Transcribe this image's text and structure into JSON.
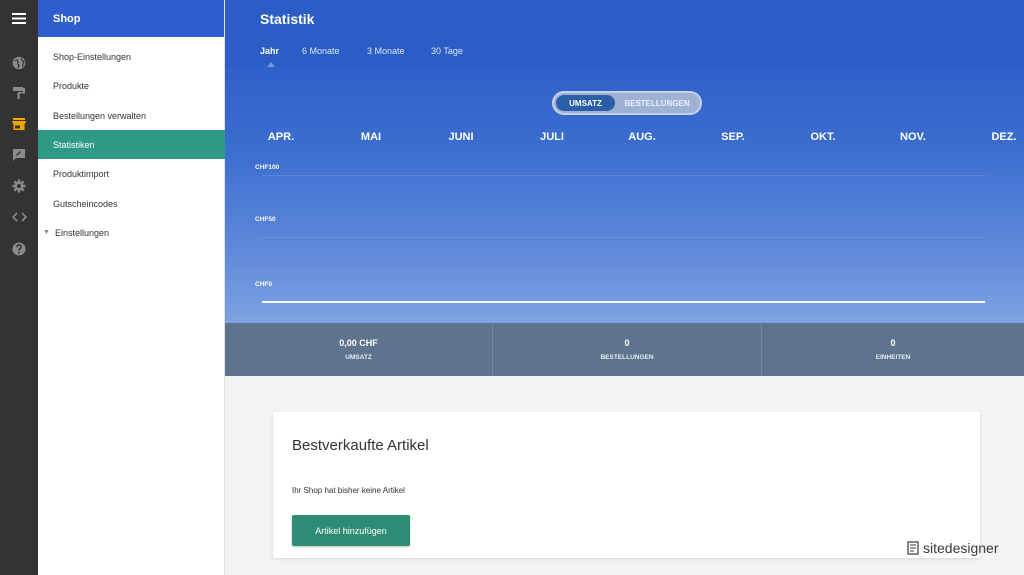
{
  "rail": {
    "icons": [
      "menu-icon",
      "globe-icon",
      "paint-roller-icon",
      "store-icon",
      "feedback-icon",
      "gear-icon",
      "code-icon",
      "help-icon"
    ]
  },
  "sidebar": {
    "header": "Shop",
    "items": [
      {
        "label": "Shop-Einstellungen"
      },
      {
        "label": "Produkte"
      },
      {
        "label": "Bestellungen verwalten"
      },
      {
        "label": "Statistiken",
        "active": true
      },
      {
        "label": "Produktimport"
      },
      {
        "label": "Gutscheincodes"
      },
      {
        "label": "Einstellungen",
        "expandable": true
      }
    ]
  },
  "header": {
    "title": "Statistik",
    "tabs": [
      {
        "label": "Jahr",
        "active": true
      },
      {
        "label": "6 Monate"
      },
      {
        "label": "3 Monate"
      },
      {
        "label": "30 Tage"
      }
    ]
  },
  "toggle": {
    "umsatz": "UMSATZ",
    "bestellungen": "BESTELLUNGEN",
    "selected": "UMSATZ"
  },
  "chart_data": {
    "type": "line",
    "x": [
      "APR.",
      "MAI",
      "JUNI",
      "JULI",
      "AUG.",
      "SEP.",
      "OKT.",
      "NOV.",
      "DEZ."
    ],
    "y_ticks": [
      "CHF100",
      "CHF50",
      "CHF0"
    ],
    "series": [
      {
        "values": [
          0,
          0,
          0,
          0,
          0,
          0,
          0,
          0,
          0
        ]
      }
    ],
    "ylim": [
      0,
      100
    ],
    "grid": true
  },
  "stats": [
    {
      "value": "0,00 CHF",
      "label": "UMSATZ"
    },
    {
      "value": "0",
      "label": "BESTELLUNGEN"
    },
    {
      "value": "0",
      "label": "EINHEITEN"
    }
  ],
  "card": {
    "title": "Bestverkaufte Artikel",
    "message": "Ihr Shop hat bisher keine Artikel",
    "button": "Artikel hinzufügen"
  },
  "brand": {
    "name": "sitedesigner"
  },
  "colors": {
    "header_blue": "#2c5cc6",
    "active_green": "#2e9a86",
    "button_green": "#2e8c75",
    "stats_slate": "#5e738d",
    "rail_dark": "#333333"
  }
}
